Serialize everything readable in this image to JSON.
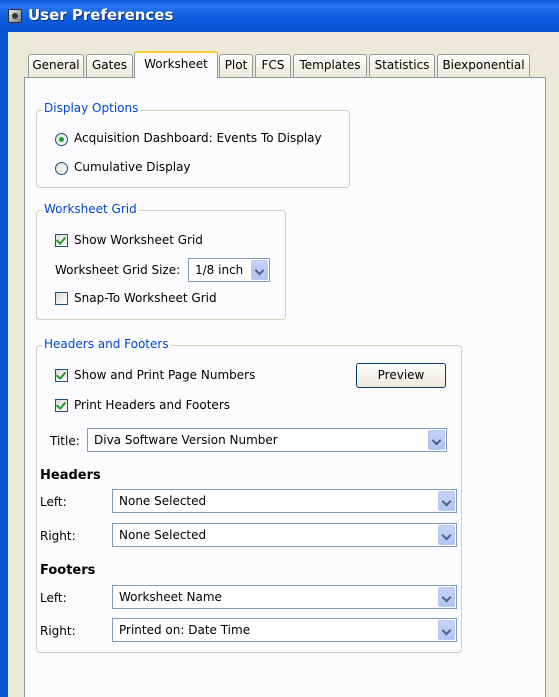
{
  "window": {
    "title": "User Preferences"
  },
  "tabs": [
    "General",
    "Gates",
    "Worksheet",
    "Plot",
    "FCS",
    "Templates",
    "Statistics",
    "Biexponential"
  ],
  "active_tab": "Worksheet",
  "display_options": {
    "legend": "Display Options",
    "acquisition_label": "Acquisition Dashboard: Events To Display",
    "cumulative_label": "Cumulative Display",
    "selected": "acquisition"
  },
  "worksheet_grid": {
    "legend": "Worksheet Grid",
    "show_grid_label": "Show Worksheet Grid",
    "show_grid_checked": true,
    "grid_size_label": "Worksheet Grid Size:",
    "grid_size_value": "1/8 inch",
    "snap_label": "Snap-To Worksheet Grid",
    "snap_checked": false
  },
  "headers_footers": {
    "legend": "Headers and Footers",
    "page_numbers_label": "Show and Print Page Numbers",
    "page_numbers_checked": true,
    "print_hf_label": "Print Headers and Footers",
    "print_hf_checked": true,
    "preview_button": "Preview",
    "title_label": "Title:",
    "title_value": "Diva Software Version Number",
    "headers_heading": "Headers",
    "footers_heading": "Footers",
    "left_label": "Left:",
    "right_label": "Right:",
    "header_left": "None Selected",
    "header_right": "None Selected",
    "footer_left": "Worksheet Name",
    "footer_right": "Printed on: Date Time"
  },
  "colors": {
    "titlebar": "#0a58d8",
    "legend_text": "#0046d5",
    "active_tab_highlight": "#ffc83c",
    "check_mark": "#21a121"
  }
}
